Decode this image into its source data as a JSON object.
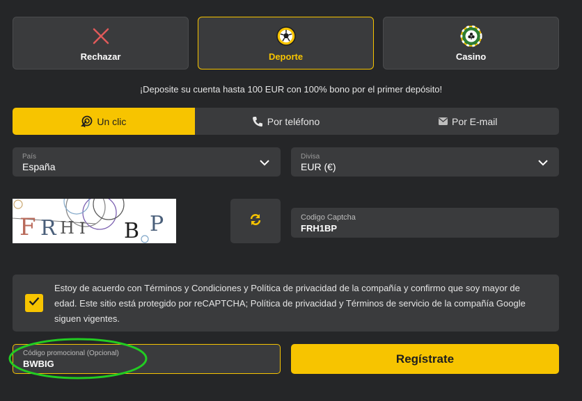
{
  "bonus_options": [
    {
      "label": "Rechazar",
      "icon": "x-icon",
      "active": false
    },
    {
      "label": "Deporte",
      "icon": "soccer-ball-icon",
      "active": true
    },
    {
      "label": "Casino",
      "icon": "casino-chip-icon",
      "active": false
    }
  ],
  "promo_text": "¡Deposite su cuenta hasta 100 EUR con 100% bono por el primer depósito!",
  "registration_tabs": [
    {
      "label": "Un clic",
      "icon": "one-click-icon",
      "active": true
    },
    {
      "label": "Por teléfono",
      "icon": "phone-icon",
      "active": false
    },
    {
      "label": "Por E-mail",
      "icon": "envelope-icon",
      "active": false
    }
  ],
  "country": {
    "label": "País",
    "value": "España"
  },
  "currency": {
    "label": "Divisa",
    "value": "EUR (€)"
  },
  "captcha": {
    "image_text": "FRHIBP",
    "label": "Codigo Captcha",
    "value": "FRH1BP"
  },
  "terms": {
    "checked": true,
    "text": "Estoy de acuerdo con Términos y Condiciones y Política de privacidad de la compañía y confirmo que soy mayor de edad. Este sitio está protegido por reCAPTCHA; Política de privacidad y Términos de servicio de la compañía Google siguen vigentes."
  },
  "promo_code": {
    "label": "Código promocional (Opcional)",
    "value": "BWBIG"
  },
  "register_button": "Regístrate",
  "colors": {
    "accent": "#f7c400",
    "background": "#252628",
    "panel": "#3a3b3d",
    "highlight": "#22cc22"
  }
}
